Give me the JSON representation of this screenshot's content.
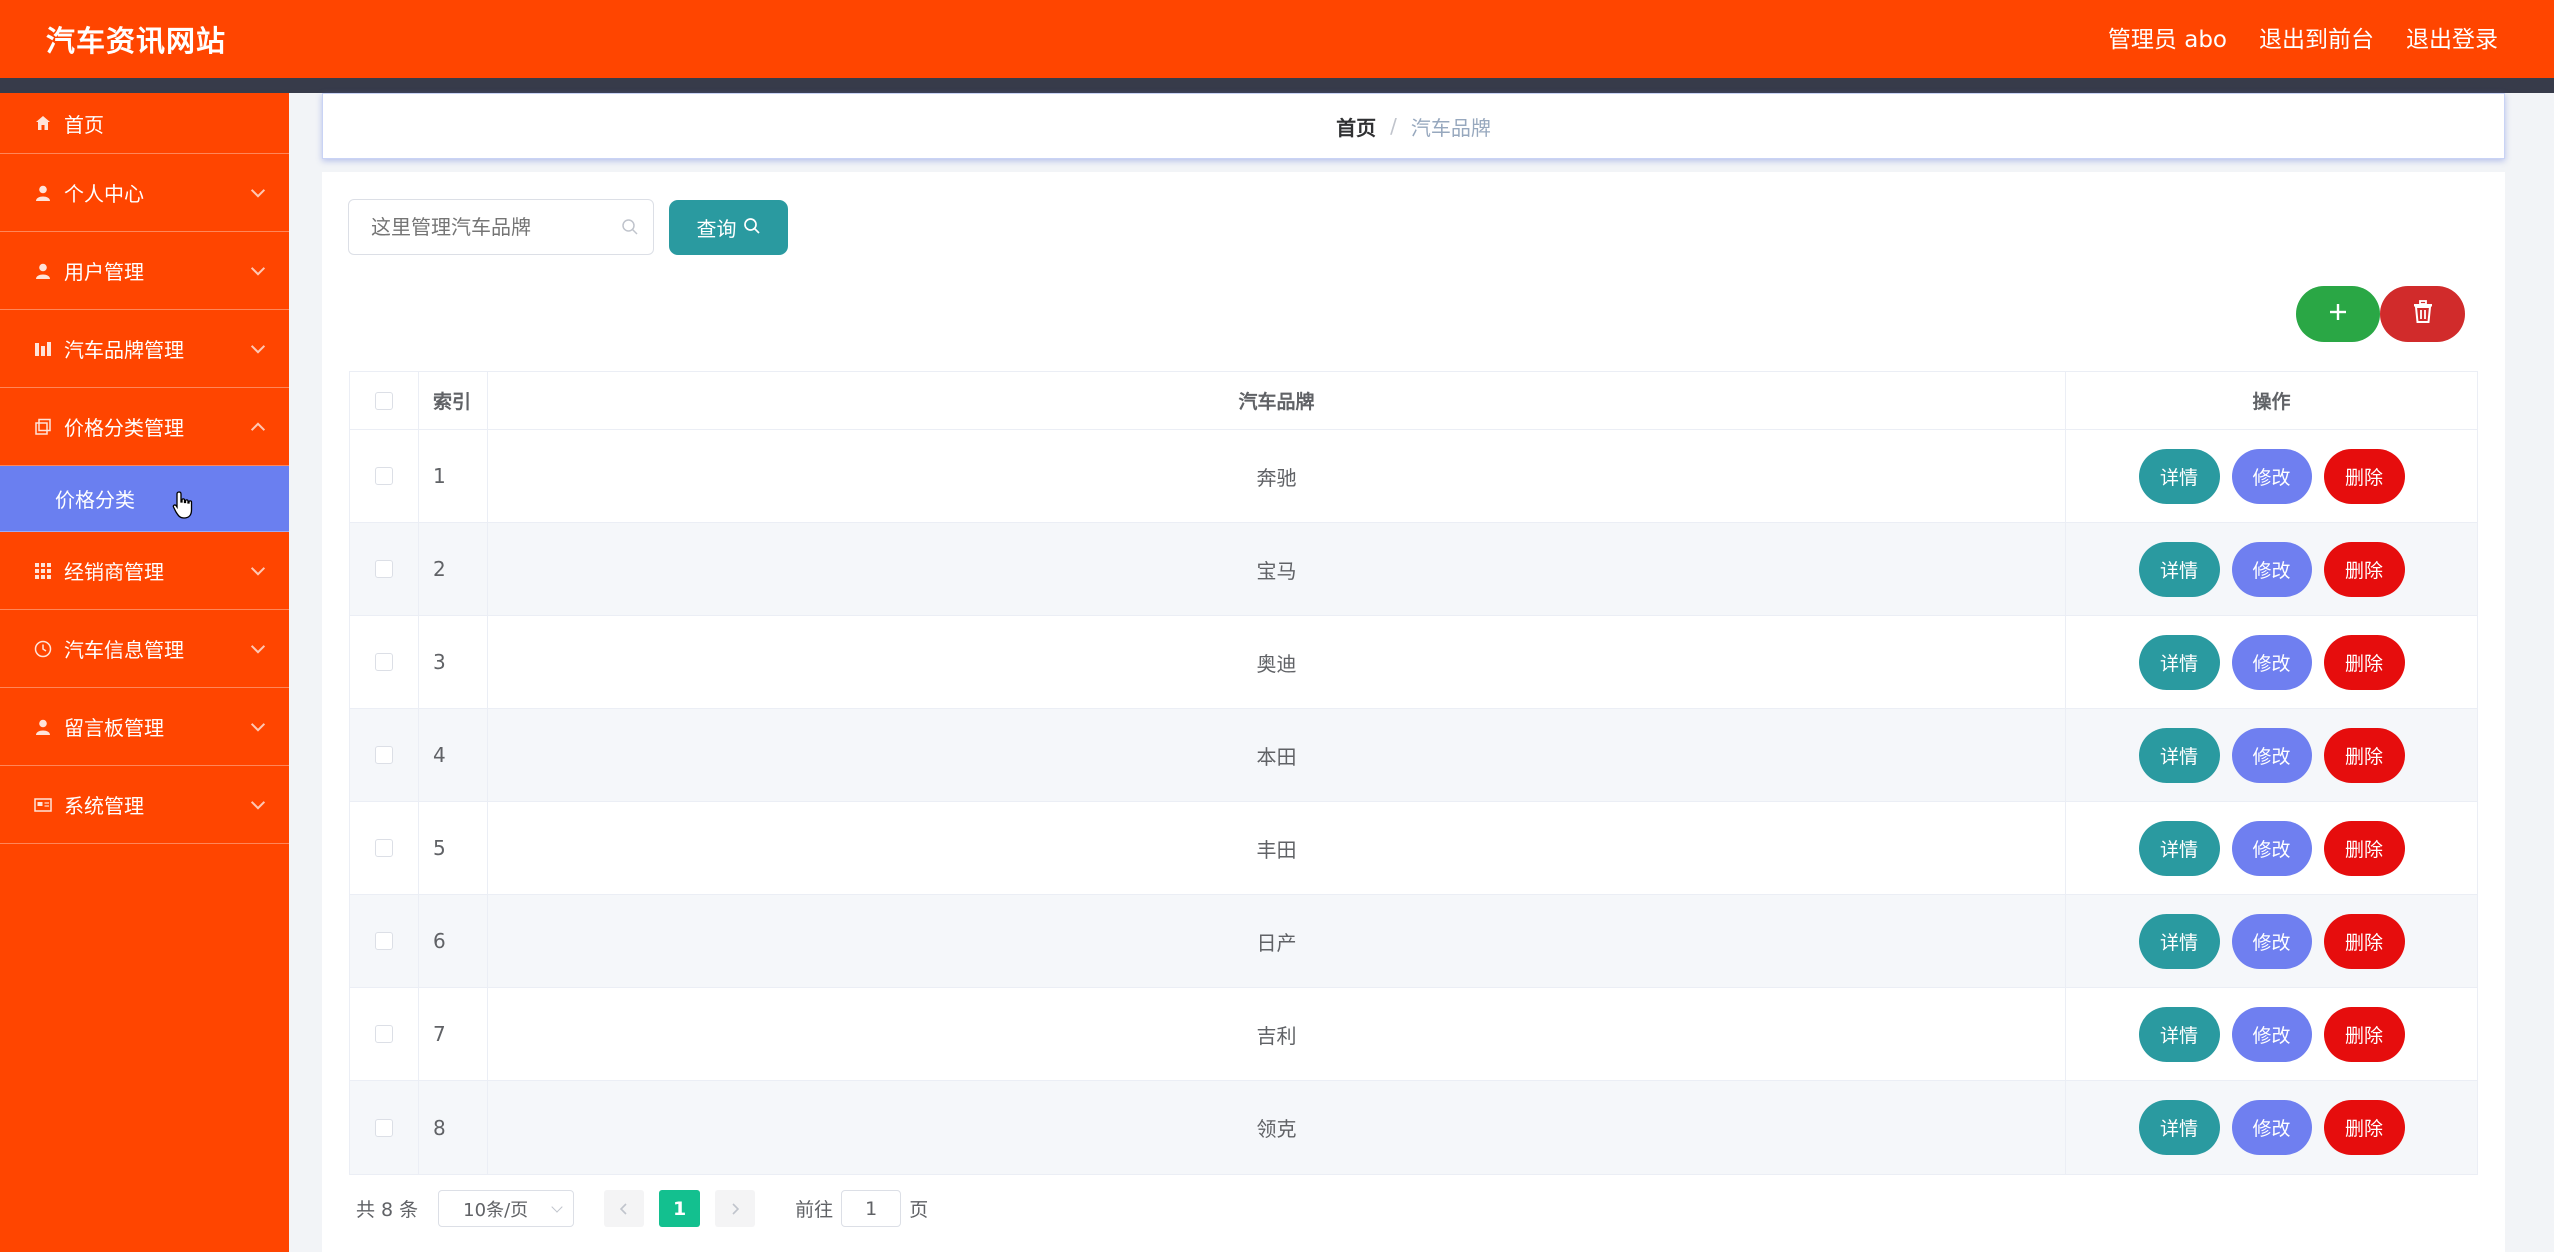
{
  "header": {
    "brand": "汽车资讯网站",
    "admin": "管理员 abo",
    "back_front": "退出到前台",
    "logout": "退出登录"
  },
  "sidebar": {
    "items": [
      {
        "label": "首页",
        "icon": "home-icon"
      },
      {
        "label": "个人中心",
        "icon": "user-icon"
      },
      {
        "label": "用户管理",
        "icon": "user-icon"
      },
      {
        "label": "汽车品牌管理",
        "icon": "chart-icon"
      },
      {
        "label": "价格分类管理",
        "icon": "copy-icon"
      },
      {
        "label": "经销商管理",
        "icon": "grid-icon"
      },
      {
        "label": "汽车信息管理",
        "icon": "clock-icon"
      },
      {
        "label": "留言板管理",
        "icon": "user-icon"
      },
      {
        "label": "系统管理",
        "icon": "card-icon"
      }
    ],
    "submenu_active": "价格分类"
  },
  "breadcrumb": {
    "home": "首页",
    "separator": "/",
    "current": "汽车品牌"
  },
  "search": {
    "placeholder": "这里管理汽车品牌",
    "button_label": "查询"
  },
  "table": {
    "headers": {
      "index": "索引",
      "name": "汽车品牌",
      "ops": "操作"
    },
    "rows": [
      {
        "index": "1",
        "name": "奔驰"
      },
      {
        "index": "2",
        "name": "宝马"
      },
      {
        "index": "3",
        "name": "奥迪"
      },
      {
        "index": "4",
        "name": "本田"
      },
      {
        "index": "5",
        "name": "丰田"
      },
      {
        "index": "6",
        "name": "日产"
      },
      {
        "index": "7",
        "name": "吉利"
      },
      {
        "index": "8",
        "name": "领克"
      }
    ],
    "op_labels": {
      "detail": "详情",
      "edit": "修改",
      "delete": "删除"
    }
  },
  "pagination": {
    "total": "共 8 条",
    "page_size": "10条/页",
    "current_page": "1",
    "goto_prefix": "前往",
    "goto_value": "1",
    "goto_suffix": "页"
  },
  "colors": {
    "primary": "#ff4500",
    "dark_strip": "#373b4a",
    "submenu_active": "#6a7ff0",
    "teal": "#2a9aa0",
    "edit": "#6f7ff0",
    "danger": "#e60d0d",
    "add": "#2aa745",
    "page_active": "#13c08f"
  }
}
